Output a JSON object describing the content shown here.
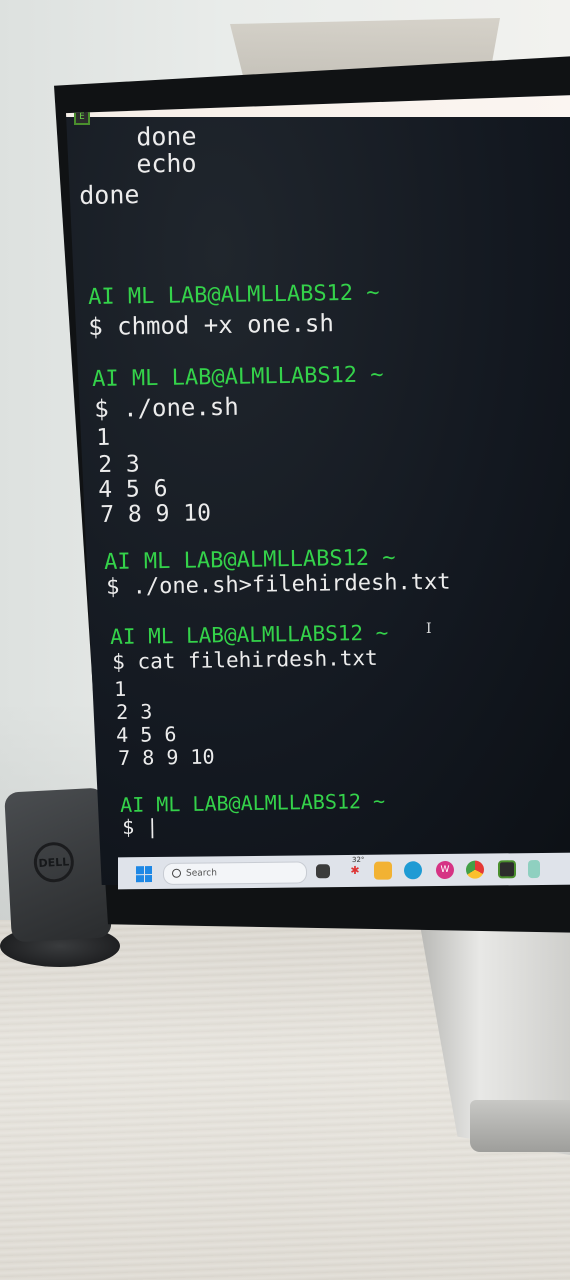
{
  "terminal": {
    "lines": [
      {
        "text": "  done",
        "kind": "output"
      },
      {
        "text": "  echo",
        "kind": "output"
      },
      {
        "text": "done",
        "kind": "output"
      },
      {
        "text": "AI ML LAB@ALMLLABS12 ~",
        "kind": "prompt"
      },
      {
        "text": "$ chmod +x one.sh",
        "kind": "command"
      },
      {
        "text": "AI ML LAB@ALMLLABS12 ~",
        "kind": "prompt"
      },
      {
        "text": "$ ./one.sh",
        "kind": "command"
      },
      {
        "text": "1",
        "kind": "output"
      },
      {
        "text": "2 3",
        "kind": "output"
      },
      {
        "text": "4 5 6",
        "kind": "output"
      },
      {
        "text": "7 8 9 10",
        "kind": "output"
      },
      {
        "text": "AI ML LAB@ALMLLABS12 ~",
        "kind": "prompt"
      },
      {
        "text": "$ ./one.sh>filehirdesh.txt",
        "kind": "command"
      },
      {
        "text": "AI ML LAB@ALMLLABS12 ~",
        "kind": "prompt"
      },
      {
        "text": "$ cat filehirdesh.txt",
        "kind": "command"
      },
      {
        "text": "1",
        "kind": "output"
      },
      {
        "text": "2 3",
        "kind": "output"
      },
      {
        "text": "4 5 6",
        "kind": "output"
      },
      {
        "text": "7 8 9 10",
        "kind": "output"
      },
      {
        "text": "AI ML LAB@ALMLLABS12 ~",
        "kind": "prompt"
      },
      {
        "text": "$ |",
        "kind": "command"
      }
    ],
    "colors": {
      "prompt": "#34d24a",
      "text": "#ececec",
      "background": "#131820"
    }
  },
  "taskbar": {
    "search_placeholder": "Search",
    "weather_temp": "32°",
    "icons": [
      "windows-start-icon",
      "search-icon",
      "file-explorer-icon",
      "weather-icon",
      "folder-icon",
      "edge-icon",
      "wps-office-icon",
      "chrome-icon",
      "terminal-icon",
      "notepad-icon"
    ]
  },
  "device_logo": "DELL"
}
